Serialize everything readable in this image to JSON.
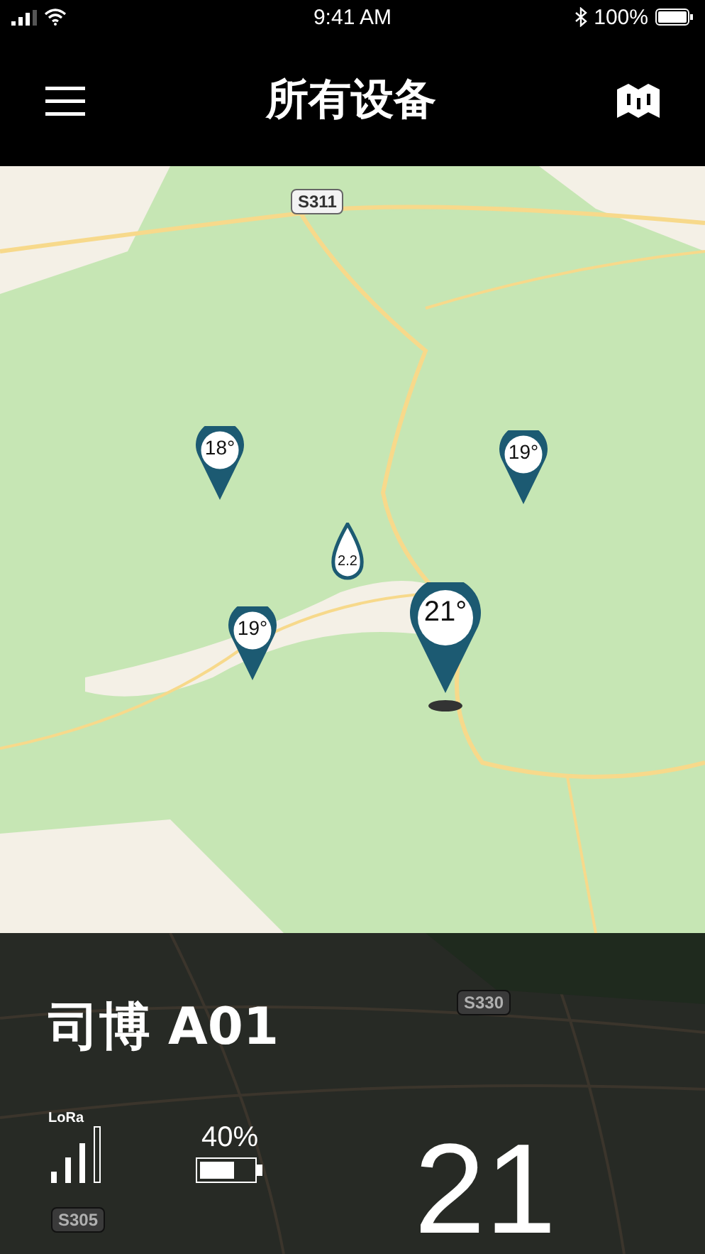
{
  "status_bar": {
    "time": "9:41 AM",
    "battery": "100%"
  },
  "header": {
    "title": "所有设备"
  },
  "map": {
    "road_labels": [
      "S311"
    ],
    "pins": [
      {
        "kind": "temperature",
        "label": "18°",
        "selected": false
      },
      {
        "kind": "temperature",
        "label": "19°",
        "selected": false
      },
      {
        "kind": "drop",
        "label": "2.2",
        "selected": false
      },
      {
        "kind": "temperature",
        "label": "19°",
        "selected": false
      },
      {
        "kind": "temperature",
        "label": "21°",
        "selected": true
      }
    ]
  },
  "device_panel": {
    "road_labels": [
      "S330",
      "S305"
    ],
    "name": "司博 A01",
    "network": "LoRa",
    "battery": "40%",
    "temperature": "21"
  }
}
